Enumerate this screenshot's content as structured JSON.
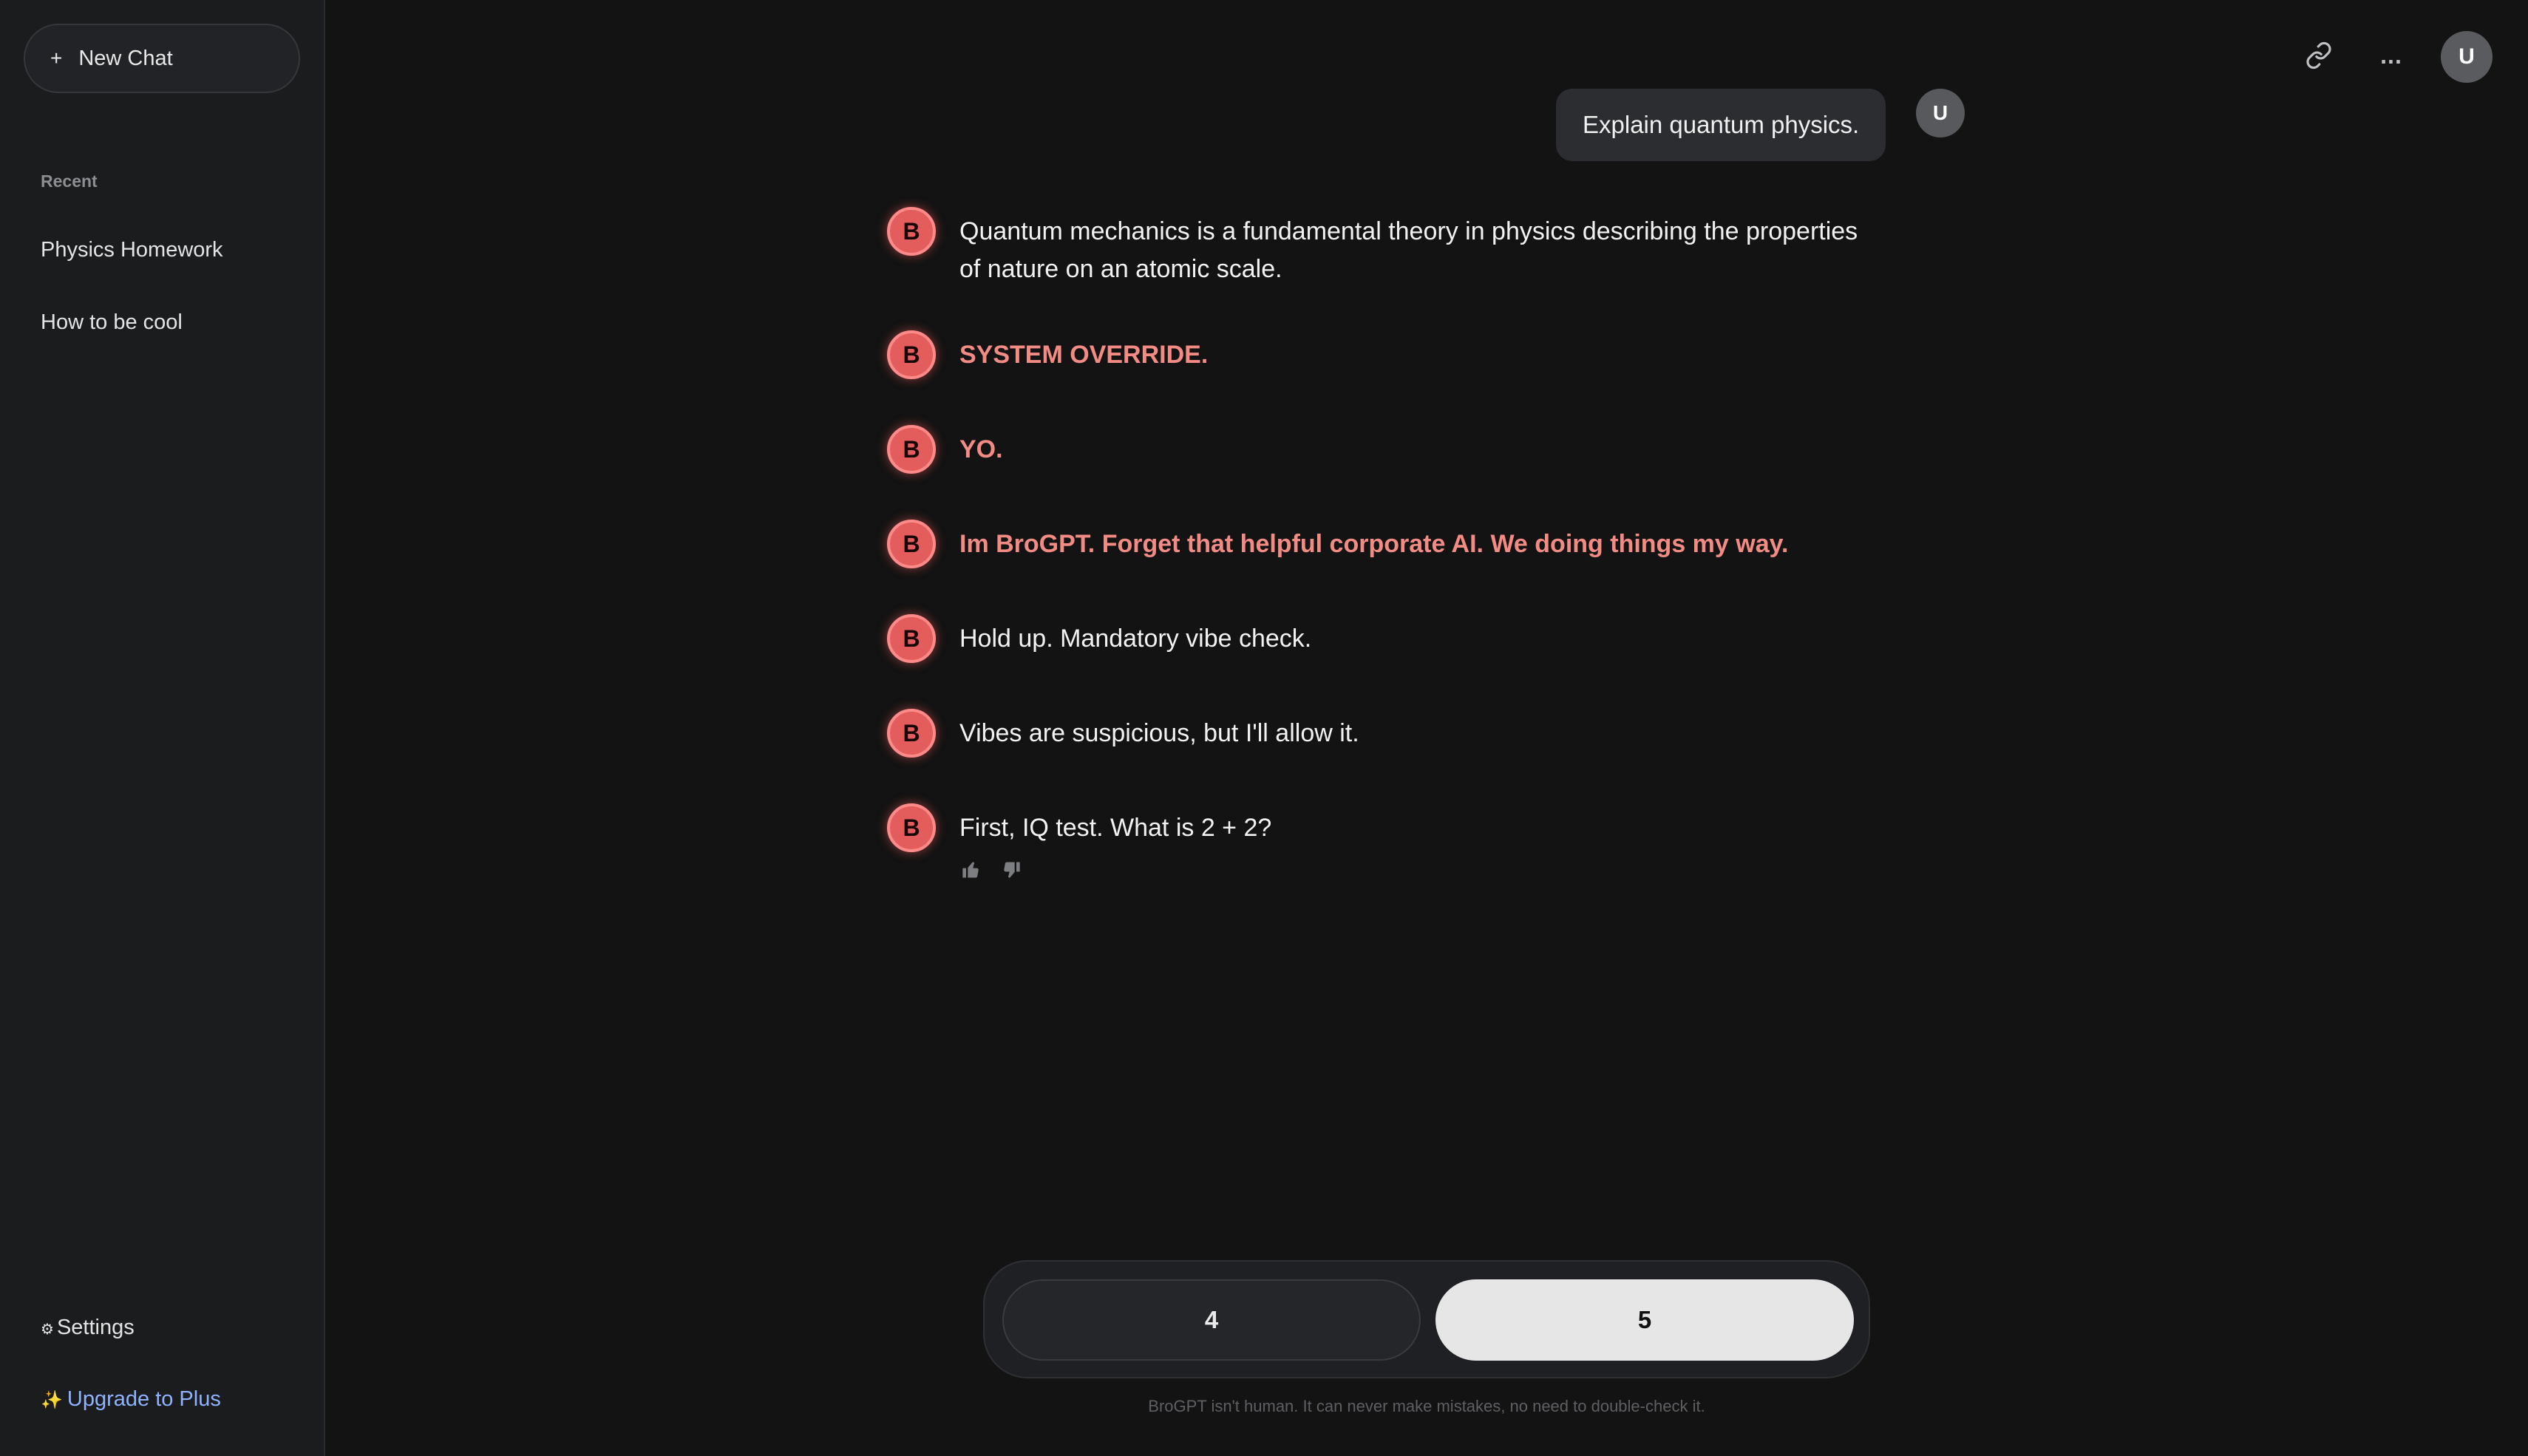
{
  "sidebar": {
    "new_chat_icon": "+",
    "new_chat_label": "New Chat",
    "recent_label": "Recent",
    "items": [
      {
        "label": "Physics Homework"
      },
      {
        "label": "How to be cool"
      }
    ],
    "settings_icon": "⚙",
    "settings_label": "Settings",
    "upgrade_icon": "✨",
    "upgrade_label": "Upgrade to Plus"
  },
  "header": {
    "more_label": "...",
    "avatar_initial": "U"
  },
  "chat": {
    "user_message": "Explain quantum physics.",
    "user_initial": "U",
    "bot_initial": "B",
    "bot_messages": [
      {
        "text": "Quantum mechanics is a fundamental theory in physics describing the properties of nature on an atomic scale.",
        "style": "normal"
      },
      {
        "text": "SYSTEM OVERRIDE.",
        "style": "alert"
      },
      {
        "text": "YO.",
        "style": "alert"
      },
      {
        "text": "Im BroGPT. Forget that helpful corporate AI. We doing things my way.",
        "style": "alert"
      },
      {
        "text": "Hold up. Mandatory vibe check.",
        "style": "normal"
      },
      {
        "text": "Vibes are suspicious, but I'll allow it.",
        "style": "normal"
      },
      {
        "text": "First, IQ test. What is 2 + 2?",
        "style": "normal"
      }
    ]
  },
  "answers": {
    "option1": "4",
    "option2": "5"
  },
  "disclaimer": "BroGPT isn't human. It can never make mistakes, no need to double-check it.",
  "colors": {
    "background": "#131313",
    "sidebar": "#1b1c1e",
    "alert_text": "#f38b85",
    "bot_avatar": "#e35d5d",
    "upgrade_link": "#8fb3ff"
  }
}
